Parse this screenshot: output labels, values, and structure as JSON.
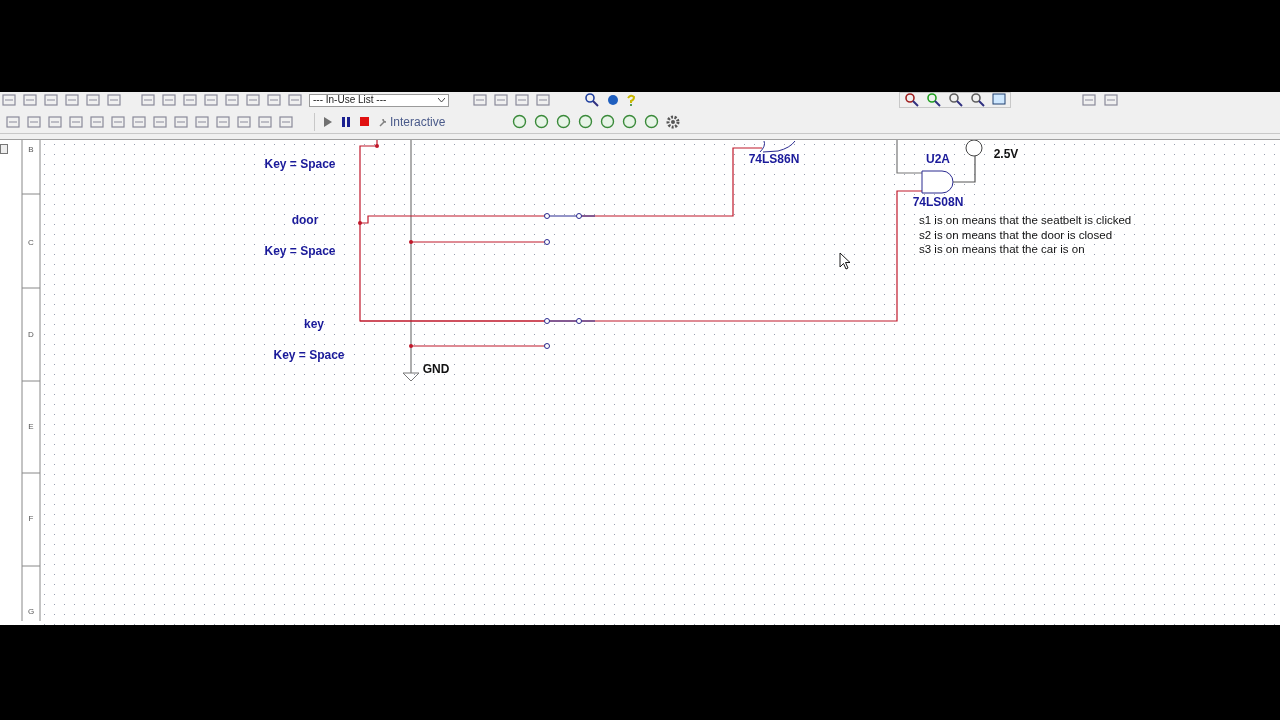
{
  "toolbar": {
    "in_use_list": "--- In-Use List ---",
    "mode": "Interactive"
  },
  "sheet": {
    "row_markers": [
      "B",
      "C",
      "D",
      "E",
      "F",
      "G"
    ],
    "labels": [
      {
        "kind": "part",
        "text": "Key = Space"
      },
      {
        "kind": "part",
        "text": "door"
      },
      {
        "kind": "part",
        "text": "Key = Space"
      },
      {
        "kind": "part",
        "text": "key"
      },
      {
        "kind": "part",
        "text": "Key = Space"
      },
      {
        "kind": "net",
        "text": "GND"
      },
      {
        "kind": "part",
        "text": "74LS86N"
      },
      {
        "kind": "part",
        "text": "U2A"
      },
      {
        "kind": "part",
        "text": "74LS08N"
      },
      {
        "kind": "net",
        "text": "2.5V"
      }
    ],
    "notes": [
      "s1 is on means that the seatbelt is clicked",
      "s2 is on means that the door is closed",
      "s3 is on means that the car is on"
    ]
  }
}
